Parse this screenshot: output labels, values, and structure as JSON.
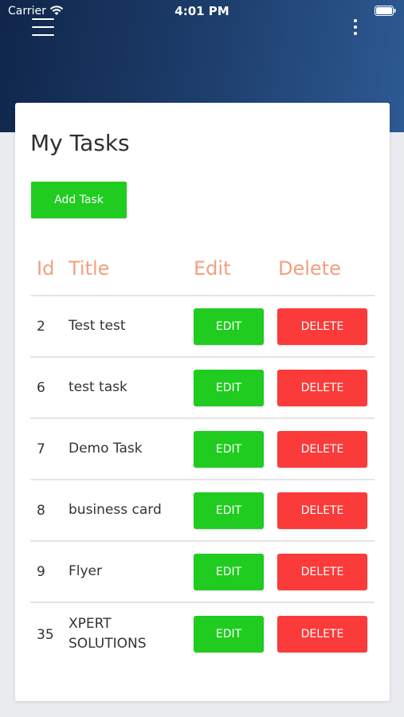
{
  "status_bar": {
    "carrier": "Carrier",
    "time": "4:01 PM",
    "icons": [
      "wifi-icon",
      "battery-icon"
    ]
  },
  "nav": {
    "menu_icon": "hamburger-icon",
    "more_icon": "more-vertical-icon"
  },
  "colors": {
    "header_start": "#10264a",
    "header_end": "#2d5a93",
    "accent_green": "#1fcc1f",
    "accent_red": "#fb3a3a",
    "header_text": "#f2a07f"
  },
  "page": {
    "title": "My Tasks",
    "add_task_label": "Add Task"
  },
  "table": {
    "columns": [
      "Id",
      "Title",
      "Edit",
      "Delete"
    ],
    "edit_label": "EDIT",
    "delete_label": "DELETE",
    "rows": [
      {
        "id": "2",
        "title": "Test test"
      },
      {
        "id": "6",
        "title": "test task"
      },
      {
        "id": "7",
        "title": "Demo Task"
      },
      {
        "id": "8",
        "title": "business card"
      },
      {
        "id": "9",
        "title": "Flyer"
      },
      {
        "id": "35",
        "title": "XPERT SOLUTIONS"
      }
    ]
  }
}
